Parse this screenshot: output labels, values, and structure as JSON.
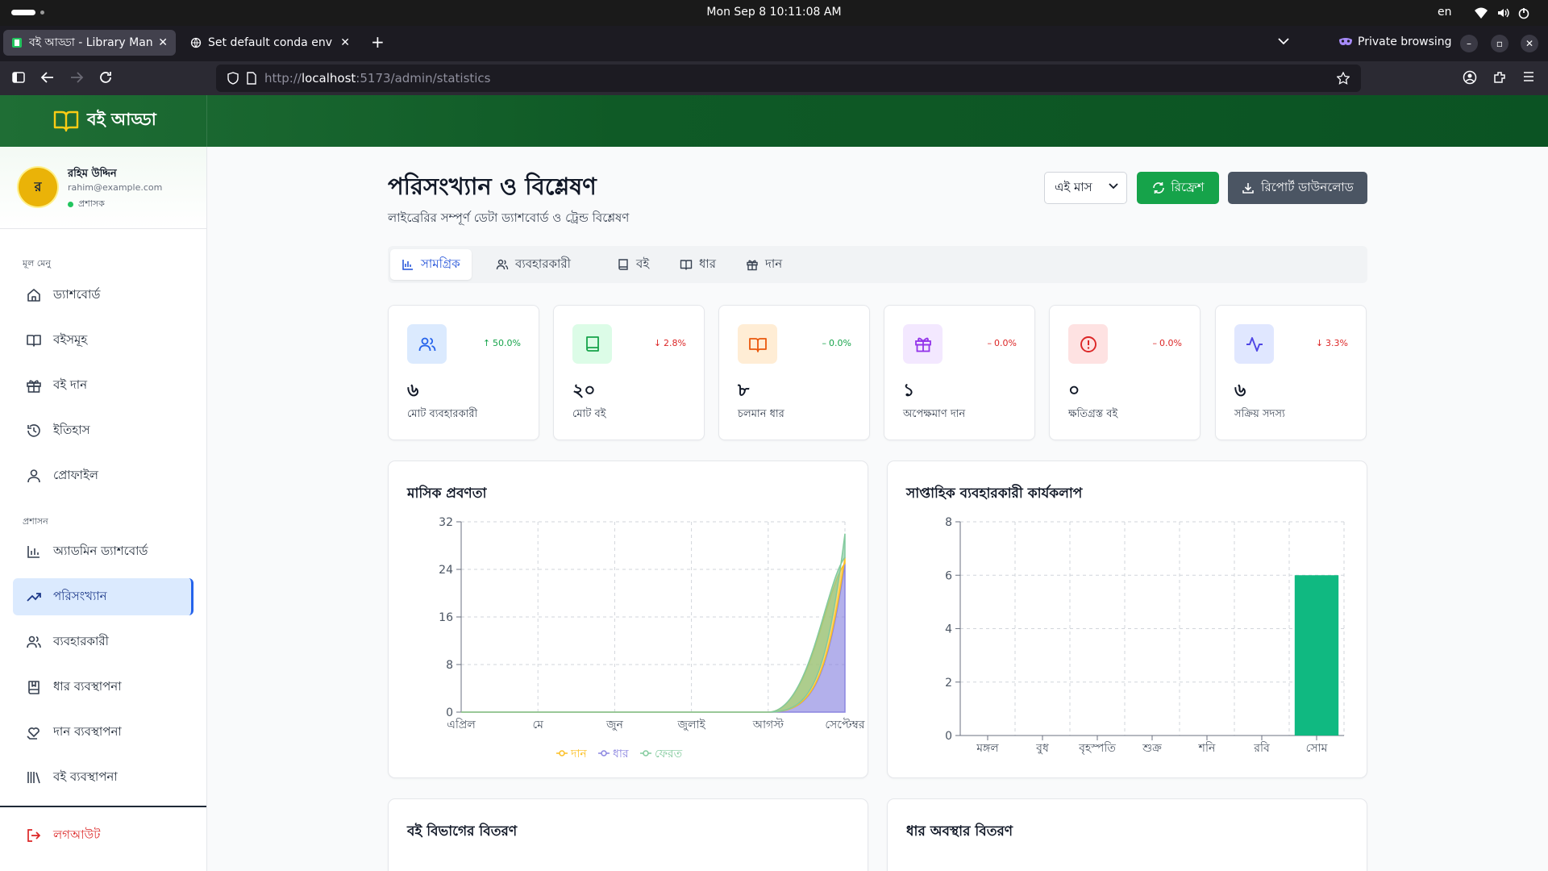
{
  "os": {
    "clock": "Mon Sep 8  10:11:08 AM",
    "lang": "en"
  },
  "browser": {
    "tabs": [
      {
        "title": "বই আড্ডা - Library Manager",
        "active": true
      },
      {
        "title": "Set default conda env",
        "active": false
      }
    ],
    "private_label": "Private browsing",
    "url_prefix": "http://",
    "url_host": "localhost",
    "url_path": ":5173/admin/statistics"
  },
  "app": {
    "brand": "বই আড্ডা",
    "user": {
      "initial": "র",
      "name": "রহিম উদ্দিন",
      "email": "rahim@example.com",
      "role": "প্রশাসক"
    },
    "sidebar": {
      "main_label": "মূল মেনু",
      "main_items": [
        {
          "label": "ড্যাশবোর্ড",
          "icon": "home-icon"
        },
        {
          "label": "বইসমূহ",
          "icon": "book-open-icon"
        },
        {
          "label": "বই দান",
          "icon": "gift-icon"
        },
        {
          "label": "ইতিহাস",
          "icon": "history-icon"
        },
        {
          "label": "প্রোফাইল",
          "icon": "user-icon"
        }
      ],
      "admin_label": "প্রশাসন",
      "admin_items": [
        {
          "label": "অ্যাডমিন ড্যাশবোর্ড",
          "icon": "bar-chart-icon"
        },
        {
          "label": "পরিসংখ্যান",
          "icon": "trending-up-icon",
          "active": true
        },
        {
          "label": "ব্যবহারকারী",
          "icon": "users-icon"
        },
        {
          "label": "ধার ব্যবস্থাপনা",
          "icon": "book-bookmark-icon"
        },
        {
          "label": "দান ব্যবস্থাপনা",
          "icon": "hand-heart-icon"
        },
        {
          "label": "বই ব্যবস্থাপনা",
          "icon": "library-icon"
        }
      ],
      "logout": "লগআউট"
    },
    "page": {
      "title": "পরিসংখ্যান ও বিশ্লেষণ",
      "subtitle": "লাইব্রেরির সম্পূর্ণ ডেটা ড্যাশবোর্ড ও ট্রেন্ড বিশ্লেষণ",
      "period_select": "এই মাস",
      "refresh": "রিফ্রেশ",
      "download": "রিপোর্ট ডাউনলোড",
      "tabs": [
        "সামগ্রিক",
        "ব্যবহারকারী",
        "বই",
        "ধার",
        "দান"
      ],
      "active_tab": 0
    },
    "stats": [
      {
        "value": "৬",
        "label": "মোট ব্যবহারকারী",
        "trend": "50.0%",
        "dir": "up",
        "icon": "users-icon",
        "bg": "#dbeafe",
        "fg": "#2563eb"
      },
      {
        "value": "২০",
        "label": "মোট বই",
        "trend": "2.8%",
        "dir": "down",
        "icon": "book-icon",
        "bg": "#dcfce7",
        "fg": "#16a34a"
      },
      {
        "value": "৮",
        "label": "চলমান ধার",
        "trend": "0.0%",
        "dir": "flat-up",
        "icon": "book-open-icon",
        "bg": "#ffedd5",
        "fg": "#ea580c"
      },
      {
        "value": "১",
        "label": "অপেক্ষমাণ দান",
        "trend": "0.0%",
        "dir": "flat-down",
        "icon": "gift-icon",
        "bg": "#f3e8ff",
        "fg": "#9333ea"
      },
      {
        "value": "০",
        "label": "ক্ষতিগ্রস্ত বই",
        "trend": "0.0%",
        "dir": "flat-down",
        "icon": "alert-circle-icon",
        "bg": "#fee2e2",
        "fg": "#dc2626"
      },
      {
        "value": "৬",
        "label": "সক্রিয় সদস্য",
        "trend": "3.3%",
        "dir": "down",
        "icon": "activity-icon",
        "bg": "#e0e7ff",
        "fg": "#4f46e5"
      }
    ],
    "panels": {
      "monthly_title": "মাসিক প্রবণতা",
      "weekly_title": "সাপ্তাহিক ব্যবহারকারী কার্যকলাপ",
      "category_title": "বই বিভাগের বিতরণ",
      "loan_status_title": "ধার অবস্থার বিতরণ"
    }
  },
  "chart_data": [
    {
      "type": "area",
      "title": "মাসিক প্রবণতা",
      "categories": [
        "এপ্রিল",
        "মে",
        "জুন",
        "জুলাই",
        "আগস্ট",
        "সেপ্টেম্বর"
      ],
      "series": [
        {
          "name": "দান",
          "values": [
            0,
            0,
            0,
            0,
            0,
            1
          ],
          "color": "#fbbf24"
        },
        {
          "name": "ধার",
          "values": [
            0,
            0,
            0,
            0,
            0,
            25
          ],
          "color": "#8b85e0"
        },
        {
          "name": "ফেরত",
          "values": [
            0,
            0,
            0,
            0,
            0,
            4
          ],
          "color": "#82ca9d"
        }
      ],
      "stacked": true,
      "ylim": [
        0,
        32
      ],
      "yticks": [
        0,
        8,
        16,
        24,
        32
      ],
      "grid": true,
      "legend": "bottom"
    },
    {
      "type": "bar",
      "title": "সাপ্তাহিক ব্যবহারকারী কার্যকলাপ",
      "categories": [
        "মঙ্গল",
        "বুধ",
        "বৃহস্পতি",
        "শুক্র",
        "শনি",
        "রবি",
        "সোম"
      ],
      "values": [
        0,
        0,
        0,
        0,
        0,
        0,
        6
      ],
      "color": "#10b981",
      "ylim": [
        0,
        8
      ],
      "yticks": [
        0,
        2,
        4,
        6,
        8
      ],
      "grid": true
    }
  ]
}
